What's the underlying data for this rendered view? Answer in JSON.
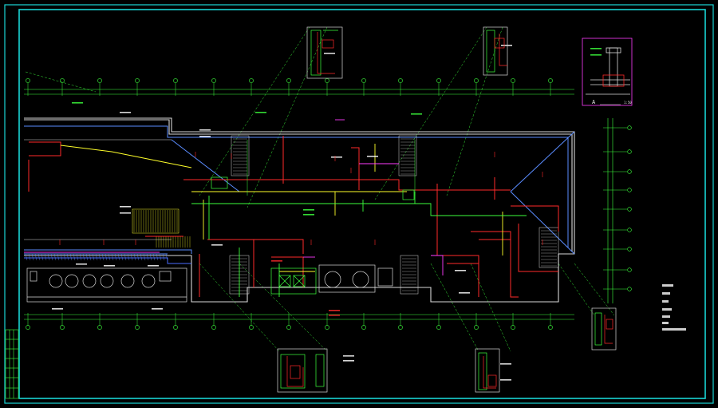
{
  "drawing": {
    "colors": {
      "frame": "#1ad4d4",
      "wall": "#d8d8d8",
      "grid": "#3cff3c",
      "pipe_red": "#ff2a2a",
      "pipe_yellow": "#ffff2a",
      "pipe_magenta": "#ff3cff",
      "duct_blue": "#5a8cff",
      "background": "#000000"
    },
    "section_label": "A",
    "section_scale": "1:50"
  }
}
